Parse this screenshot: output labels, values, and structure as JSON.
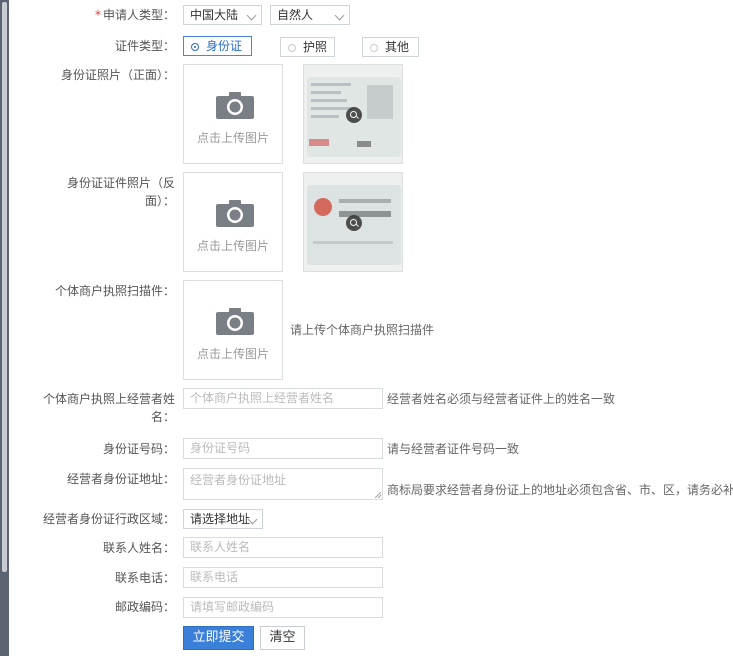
{
  "form": {
    "applicant_type": {
      "label": "申请人类型：",
      "required_mark": "*",
      "region_value": "中国大陆",
      "person_value": "自然人"
    },
    "id_type": {
      "label": "证件类型：",
      "options": [
        "身份证",
        "护照",
        "其他"
      ],
      "selected_index": 0
    },
    "id_front": {
      "label": "身份证照片（正面）：",
      "upload_text": "点击上传图片"
    },
    "id_back": {
      "label_line1": "身份证证件照片（反",
      "label_line2": "面）：",
      "upload_text": "点击上传图片"
    },
    "license_scan": {
      "label": "个体商户执照扫描件：",
      "upload_text": "点击上传图片",
      "hint": "请上传个体商户执照扫描件"
    },
    "operator_name": {
      "label_line1": "个体商户执照上经营者姓",
      "label_line2": "名：",
      "placeholder": "个体商户执照上经营者姓名",
      "hint": "经营者姓名必须与经营者证件上的姓名一致"
    },
    "id_number": {
      "label": "身份证号码：",
      "placeholder": "身份证号码",
      "hint": "请与经营者证件号码一致"
    },
    "id_address": {
      "label": "经营者身份证地址：",
      "placeholder": "经营者身份证地址",
      "hint": "商标局要求经营者身份证上的地址必须包含省、市、区，请务必补"
    },
    "admin_region": {
      "label": "经营者身份证行政区域：",
      "value": "请选择地址"
    },
    "contact_name": {
      "label": "联系人姓名：",
      "placeholder": "联系人姓名"
    },
    "contact_phone": {
      "label": "联系电话：",
      "placeholder": "联系电话"
    },
    "postal_code": {
      "label": "邮政编码：",
      "placeholder": "请填写邮政编码"
    },
    "actions": {
      "submit_label": "立即提交",
      "clear_label": "清空"
    }
  },
  "colors": {
    "primary": "#3a7fd8",
    "required": "#e4393c",
    "border": "#cfd4da",
    "text": "#555555",
    "placeholder": "#bbbbbb"
  },
  "icons": {
    "upload": "camera-icon",
    "preview": "zoom-icon",
    "select": "chevron-down-icon"
  }
}
